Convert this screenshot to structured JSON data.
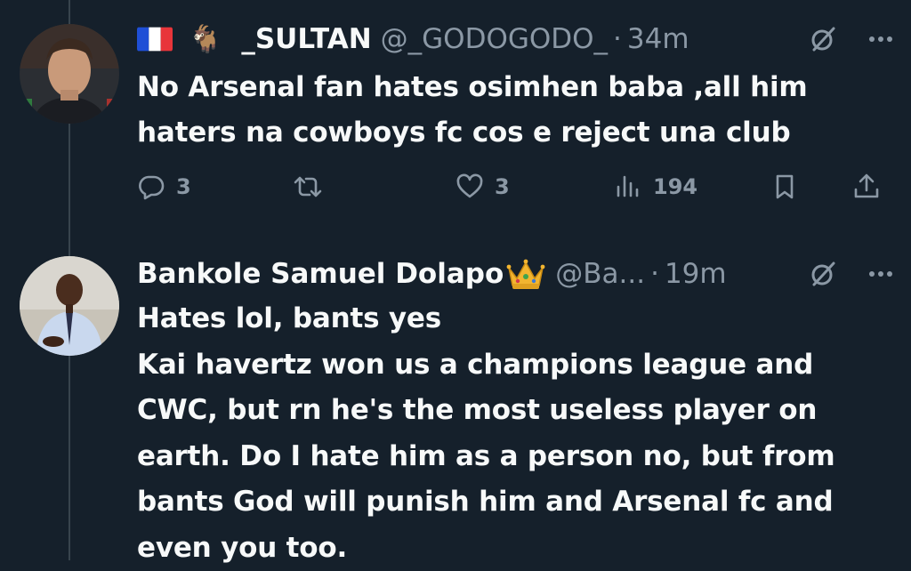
{
  "colors": {
    "background": "#15202b",
    "text_primary": "#f7f9f9",
    "text_secondary": "#8b98a5",
    "thread_line": "#38444d"
  },
  "tweets": [
    {
      "flag_icon": "france-flag-icon",
      "emoji": "🐐",
      "display_name": "_SULTAN",
      "handle": "@_GODOGODO_",
      "separator": "·",
      "time": "34m",
      "text": "No Arsenal fan hates osimhen baba ,all him\nhaters na cowboys fc cos e reject una club",
      "replies": "3",
      "retweets": "",
      "likes": "3",
      "views": "194"
    },
    {
      "display_name": "Bankole Samuel Dolapo",
      "badge_icon": "crown-icon",
      "handle": "@Ba...",
      "separator": "·",
      "time": "19m",
      "text": "Hates lol, bants yes\nKai havertz won us a champions league and\nCWC, but rn he's the most useless player on\nearth. Do I hate him as a person no, but from\nbants God will punish him and Arsenal fc and\neven you too."
    }
  ]
}
